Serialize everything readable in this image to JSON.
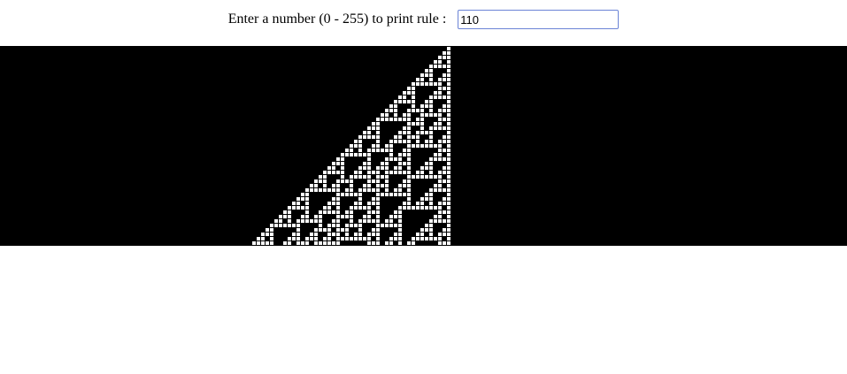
{
  "form": {
    "prompt_label": "Enter a number (0 - 255) to print rule :",
    "input_value": "110"
  },
  "automaton": {
    "rule": 110,
    "generations": 45,
    "cell_color": "#ffffff",
    "background_color": "#000000"
  }
}
